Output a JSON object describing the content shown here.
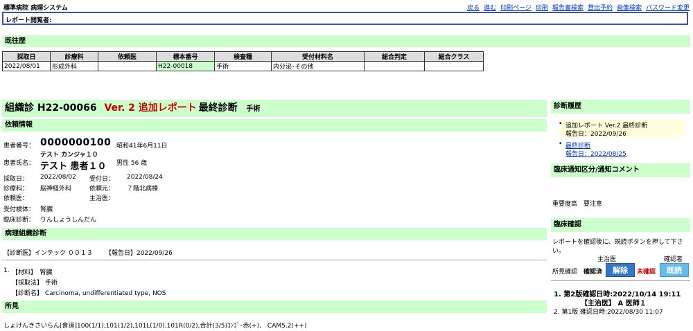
{
  "app": {
    "title": "標準病院 病理システム"
  },
  "topnav": [
    {
      "label": "戻る"
    },
    {
      "label": "進む"
    },
    {
      "label": "印刷ページ"
    },
    {
      "label": "印刷"
    },
    {
      "label": "報告書検索"
    },
    {
      "label": "貸出予約"
    },
    {
      "label": "画像検索"
    },
    {
      "label": "パスワード変更"
    }
  ],
  "viewer": {
    "label": "レポート閲覧者:"
  },
  "history": {
    "title": "既往歴",
    "headers": [
      "採取日",
      "診療科",
      "依頼医",
      "標本番号",
      "検査種",
      "受付材料名",
      "総合判定",
      "総合クラス"
    ],
    "rows": [
      [
        "2022/08/01",
        "形成外科",
        "",
        "H22-00018",
        "手術",
        "内分泌･その他",
        "",
        ""
      ]
    ]
  },
  "report": {
    "heading_prefix": "組織診 H22-00066",
    "heading_version": "Ver. 2 追加レポート",
    "heading_suffix": "最終診断",
    "heading_type": "手術"
  },
  "request": {
    "title": "依頼情報",
    "patient_no_label": "患者番号：",
    "patient_no": "0000000100",
    "birth": "昭和41年6月11日",
    "patient_name_label": "患者氏名：",
    "kana": "テスト カンジャ１０",
    "name": "テスト 患者１０",
    "sex_age": "男性 56 歳",
    "collect_date_label": "採取日：",
    "collect_date": "2022/08/02",
    "receive_date_label": "受付日：",
    "receive_date": "2022/08/24",
    "dept_label": "診療科：",
    "dept": "脳神経外科",
    "source_label": "依頼元：",
    "source": "７階北病棟",
    "doctor_label": "依頼医：",
    "attending_label": "主治医：",
    "specimen_label": "受付検体：",
    "specimen": "腎臓",
    "clinical_label": "臨床診断：",
    "clinical": "りんしょうしんだん"
  },
  "pathology": {
    "title": "病理組織診断",
    "diag_doctor": "【診断医】インテック ００１３",
    "report_date": "【報告日】2022/09/26",
    "item_no": "1.",
    "material": "【材料】　腎臓",
    "method": "【採取法】 手術",
    "diagnosis": "【診断名】 Carcinoma, undifferentiated type, NOS"
  },
  "findings": {
    "title": "所見",
    "text": "しょけんきさいらん[食道]100(1/1),101(1/2),101L(1/0),101R(0/2),合計(3/5)ｺﾝｺﾞｰ赤(+),　CAM5.2(++)"
  },
  "diag_history": {
    "title": "診断履歴",
    "items": [
      {
        "label": "追加レポート Ver.2 最終診断",
        "date": "報告日：2022/09/26"
      },
      {
        "label": "最終診断",
        "date": "報告日：2022/08/25"
      }
    ]
  },
  "clinical_notice": {
    "title": "臨床通知区分/通知コメント",
    "text": "重要度高　要注意"
  },
  "confirm": {
    "title": "臨床確認",
    "instruction": "レポートを確認後に、既読ボタンを押して下さい。",
    "attending_header": "主治医",
    "confirmer_header": "確認者",
    "row_label": "所見確認",
    "attending_status": "確認済",
    "cancel_button": "解除",
    "confirmer_status": "未確認",
    "read_button": "既読",
    "log1_line1": "1. 第2版確認日時:2022/10/14 19:11",
    "log1_line2": "【主治医】 A 医師１",
    "log2": "2. 第1版 確認日時:2022/08/30 11:07"
  },
  "colors": {
    "section_bg": "#ccffcc",
    "link": "#0033cc",
    "version_red": "#cc0000",
    "cancel_blue": "#3377cc",
    "read_blue": "#66bbee",
    "highlight": "#ffffdd"
  }
}
